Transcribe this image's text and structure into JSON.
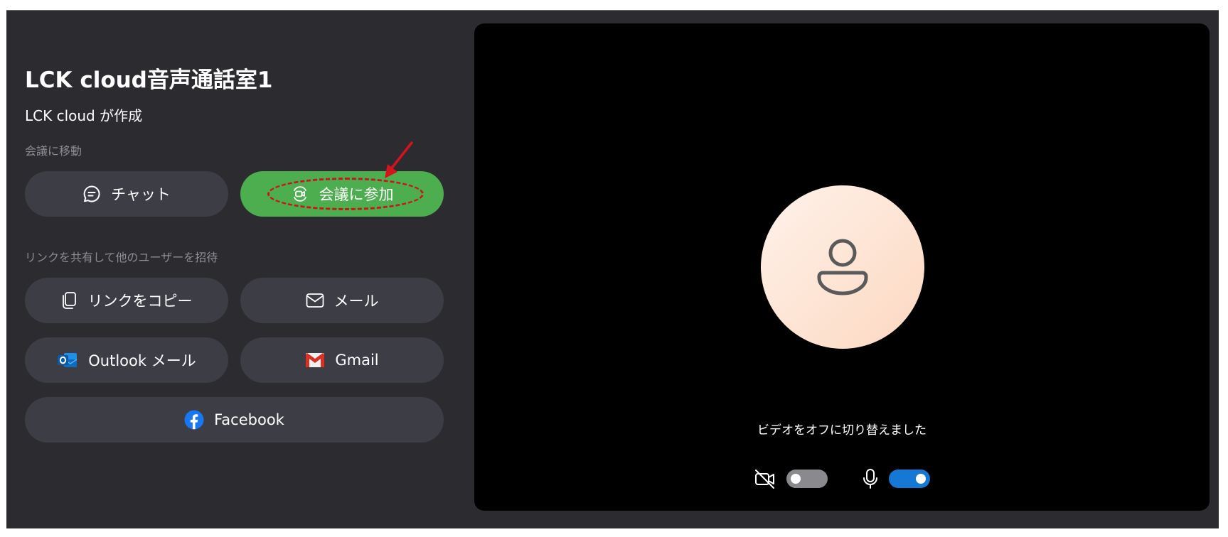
{
  "meeting": {
    "title": "LCK cloud音声通話室1",
    "creator_line": "LCK cloud が作成"
  },
  "sections": {
    "go_to_meeting": "会議に移動",
    "share_link": "リンクを共有して他のユーザーを招待"
  },
  "buttons": {
    "chat": "チャット",
    "join": "会議に参加",
    "copy_link": "リンクをコピー",
    "mail": "メール",
    "outlook": "Outlook メール",
    "gmail": "Gmail",
    "facebook": "Facebook"
  },
  "preview": {
    "status": "ビデオをオフに切り替えました",
    "camera_on": false,
    "mic_on": true
  },
  "colors": {
    "background": "#2b2b30",
    "button": "#3d3d45",
    "join_button": "#4cae4f",
    "annotation": "#c8161d",
    "toggle_on": "#1478d4"
  },
  "icons": [
    "chat-icon",
    "video-join-icon",
    "copy-icon",
    "mail-icon",
    "outlook-icon",
    "gmail-icon",
    "facebook-icon",
    "person-icon",
    "camera-off-icon",
    "microphone-icon"
  ]
}
